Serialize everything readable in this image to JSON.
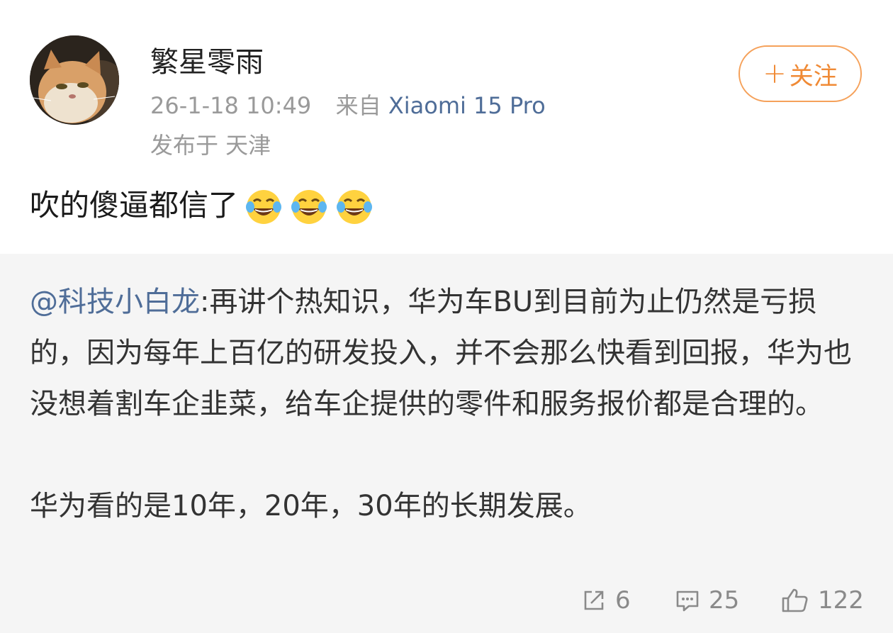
{
  "post": {
    "username": "繁星零雨",
    "timestamp": "26-1-18 10:49",
    "source_prefix": "来自",
    "device": "Xiaomi 15 Pro",
    "location": "发布于 天津",
    "follow_label": "关注",
    "follow_plus": "+",
    "text": "吹的傻逼都信了",
    "emojis": [
      "laughing-crying-emoji",
      "laughing-crying-emoji",
      "laughing-crying-emoji"
    ]
  },
  "repost": {
    "mention": "@科技小白龙",
    "paragraph1": ":再讲个热知识，华为车BU到目前为止仍然是亏损的，因为每年上百亿的研发投入，并不会那么快看到回报，华为也没想着割车企韭菜，给车企提供的零件和服务报价都是合理的。",
    "paragraph2": "华为看的是10年，20年，30年的长期发展。"
  },
  "actions": {
    "repost_count": "6",
    "comment_count": "25",
    "like_count": "122"
  },
  "colors": {
    "accent": "#f08a35",
    "link": "#4f6d98",
    "muted": "#9a9a9a",
    "repost_bg": "#f5f5f5"
  }
}
